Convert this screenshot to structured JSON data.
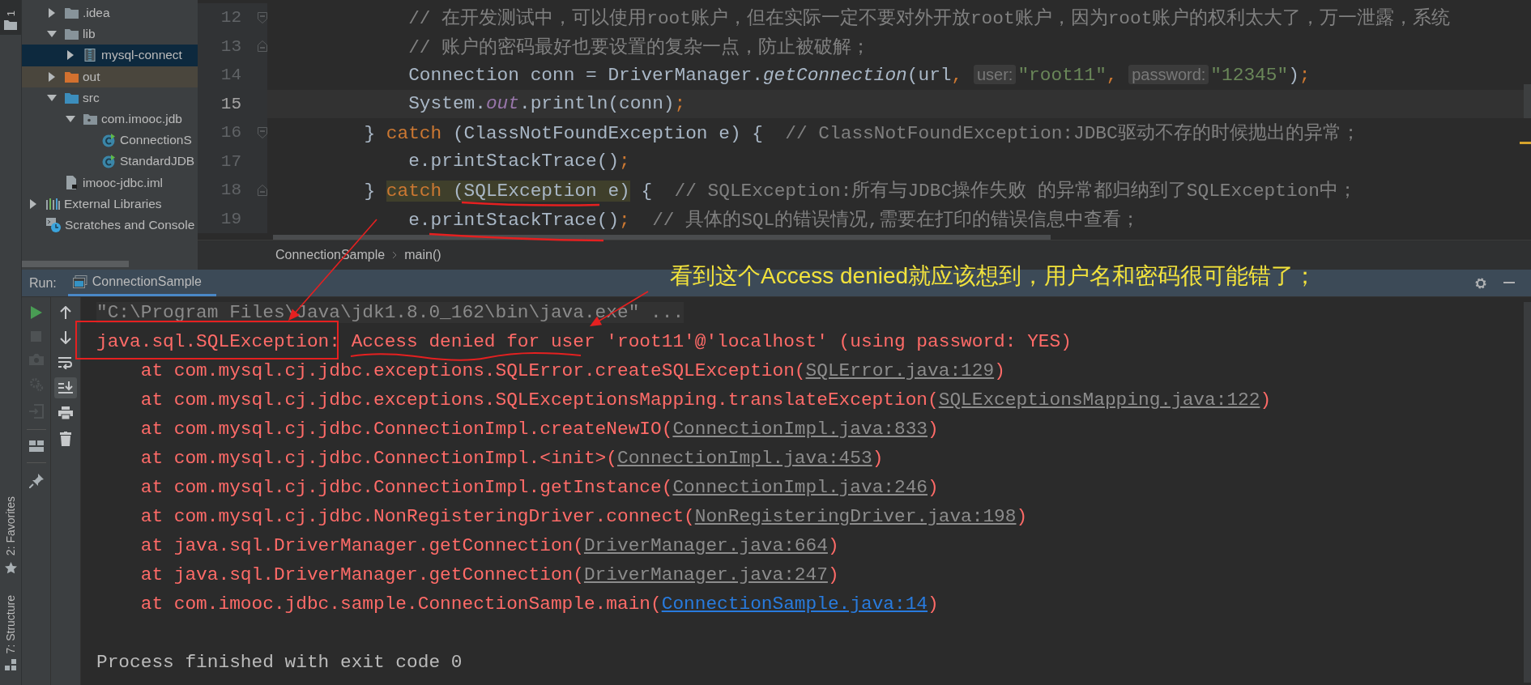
{
  "side_strip": {
    "top_tab": "1",
    "tabs": [
      {
        "label": "2: Favorites",
        "kind": "favorites"
      },
      {
        "label": "7: Structure",
        "kind": "structure"
      }
    ]
  },
  "project_tree": [
    {
      "children": [
        {
          "label": ".idea",
          "kind": "folder",
          "expanded": false,
          "selected": false
        },
        {
          "label": "lib",
          "kind": "folder",
          "expanded": true,
          "selected": false,
          "children": [
            {
              "label": "mysql-connect",
              "kind": "jar",
              "expanded": false,
              "selected": true
            }
          ]
        },
        {
          "label": "out",
          "kind": "excluded-folder",
          "expanded": false,
          "selected": false
        },
        {
          "label": "src",
          "kind": "source-folder",
          "expanded": true,
          "selected": false,
          "children": [
            {
              "label": "com.imooc.jdb",
              "kind": "package",
              "expanded": true,
              "selected": false,
              "children": [
                {
                  "label": "ConnectionS",
                  "kind": "class",
                  "selected": false
                },
                {
                  "label": "StandardJDB",
                  "kind": "class",
                  "selected": false
                }
              ]
            }
          ]
        },
        {
          "label": "imooc-jdbc.iml",
          "kind": "module-file",
          "selected": false
        }
      ]
    },
    {
      "label": "External Libraries",
      "kind": "libraries",
      "expanded": false,
      "selected": false
    },
    {
      "label": "Scratches and Console",
      "kind": "scratches",
      "selected": false
    }
  ],
  "editor": {
    "lines": [
      {
        "number": "12",
        "kind": "fold-start",
        "current": false,
        "nested": true,
        "tokens": [
          {
            "kind": "comment",
            "text": "// 在开发测试中，可以使用root账户，但在实际一定不要对外开放root账户，因为root账户的权利太大了，万一泄露，系统"
          }
        ]
      },
      {
        "number": "13",
        "kind": "fold-end",
        "current": false,
        "nested": true,
        "tokens": [
          {
            "kind": "comment",
            "text": "// 账户的密码最好也要设置的复杂一点，防止被破解；"
          }
        ]
      },
      {
        "number": "14",
        "kind": "code",
        "current": false,
        "nested": true,
        "tokens": [
          {
            "kind": "plain",
            "text": "Connection conn = DriverManager."
          },
          {
            "kind": "call",
            "text": "getConnection"
          },
          {
            "kind": "plain",
            "text": "(url"
          },
          {
            "kind": "punct",
            "text": ", "
          },
          {
            "kind": "hint",
            "text": "user:"
          },
          {
            "kind": "string",
            "text": "\"root11\""
          },
          {
            "kind": "punct",
            "text": ", "
          },
          {
            "kind": "hint",
            "text": "password:"
          },
          {
            "kind": "string",
            "text": "\"12345\""
          },
          {
            "kind": "plain",
            "text": ")"
          },
          {
            "kind": "punct",
            "text": ";"
          }
        ]
      },
      {
        "number": "15",
        "kind": "code",
        "current": true,
        "nested": true,
        "tokens": [
          {
            "kind": "plain",
            "text": "System."
          },
          {
            "kind": "field",
            "text": "out"
          },
          {
            "kind": "plain",
            "text": ".println(conn)"
          },
          {
            "kind": "punct",
            "text": ";"
          }
        ]
      },
      {
        "number": "16",
        "kind": "fold-start",
        "current": false,
        "nested": false,
        "tokens": [
          {
            "kind": "plain",
            "text": "} "
          },
          {
            "kind": "keyword",
            "text": "catch"
          },
          {
            "kind": "plain",
            "text": " (ClassNotFoundException e) {  "
          },
          {
            "kind": "comment",
            "text": "// ClassNotFoundException:JDBC驱动不存的时候抛出的异常；"
          }
        ]
      },
      {
        "number": "17",
        "kind": "code",
        "current": false,
        "nested": true,
        "tokens": [
          {
            "kind": "plain",
            "text": "e.printStackTrace()"
          },
          {
            "kind": "punct",
            "text": ";"
          }
        ]
      },
      {
        "number": "18",
        "kind": "fold-end",
        "current": false,
        "nested": false,
        "tokens": [
          {
            "kind": "plain",
            "text": "} ",
            "highlighted": false
          },
          {
            "kind": "keyword",
            "text": "catch",
            "highlighted": true
          },
          {
            "kind": "plain",
            "text": " (SQLException e)",
            "highlighted": true
          },
          {
            "kind": "plain",
            "text": " {  ",
            "highlighted": false
          },
          {
            "kind": "comment",
            "text": "// SQLException:所有与JDBC操作失败 的异常都归纳到了SQLException中；",
            "highlighted": false
          }
        ]
      },
      {
        "number": "19",
        "kind": "code",
        "current": false,
        "nested": true,
        "tokens": [
          {
            "kind": "plain",
            "text": "e.printStackTrace()"
          },
          {
            "kind": "punct",
            "text": ";"
          },
          {
            "kind": "comment",
            "text": "  // 具体的SQL的错误情况,需要在打印的错误信息中查看；"
          }
        ]
      }
    ]
  },
  "breadcrumbs": [
    "ConnectionSample",
    "main()"
  ],
  "run": {
    "label": "Run:",
    "tabs": [
      {
        "label": "ConnectionSample",
        "selected": true
      }
    ],
    "console": [
      {
        "kind": "output",
        "segments": [
          {
            "kind": "command",
            "text": "\"C:\\Program Files\\Java\\jdk1.8.0_162\\bin\\java.exe\" ..."
          }
        ]
      },
      {
        "kind": "output",
        "segments": [
          {
            "kind": "error",
            "text": "java.sql.SQLException: Access denied for user 'root11'@'localhost' (using password: YES)"
          }
        ]
      },
      {
        "kind": "frame",
        "segments": [
          {
            "kind": "error",
            "text": "at com.mysql.cj.jdbc.exceptions.SQLError.createSQLException("
          },
          {
            "kind": "link",
            "text": "SQLError.java:129"
          },
          {
            "kind": "error",
            "text": ")"
          }
        ]
      },
      {
        "kind": "frame",
        "segments": [
          {
            "kind": "error",
            "text": "at com.mysql.cj.jdbc.exceptions.SQLExceptionsMapping.translateException("
          },
          {
            "kind": "link",
            "text": "SQLExceptionsMapping.java:122"
          },
          {
            "kind": "error",
            "text": ")"
          }
        ]
      },
      {
        "kind": "frame",
        "segments": [
          {
            "kind": "error",
            "text": "at com.mysql.cj.jdbc.ConnectionImpl.createNewIO("
          },
          {
            "kind": "link",
            "text": "ConnectionImpl.java:833"
          },
          {
            "kind": "error",
            "text": ")"
          }
        ]
      },
      {
        "kind": "frame",
        "segments": [
          {
            "kind": "error",
            "text": "at com.mysql.cj.jdbc.ConnectionImpl.<init>("
          },
          {
            "kind": "link",
            "text": "ConnectionImpl.java:453"
          },
          {
            "kind": "error",
            "text": ")"
          }
        ]
      },
      {
        "kind": "frame",
        "segments": [
          {
            "kind": "error",
            "text": "at com.mysql.cj.jdbc.ConnectionImpl.getInstance("
          },
          {
            "kind": "link",
            "text": "ConnectionImpl.java:246"
          },
          {
            "kind": "error",
            "text": ")"
          }
        ]
      },
      {
        "kind": "frame",
        "segments": [
          {
            "kind": "error",
            "text": "at com.mysql.cj.jdbc.NonRegisteringDriver.connect("
          },
          {
            "kind": "link",
            "text": "NonRegisteringDriver.java:198"
          },
          {
            "kind": "error",
            "text": ")"
          }
        ]
      },
      {
        "kind": "frame",
        "segments": [
          {
            "kind": "error",
            "text": "at java.sql.DriverManager.getConnection("
          },
          {
            "kind": "link",
            "text": "DriverManager.java:664"
          },
          {
            "kind": "error",
            "text": ")"
          }
        ]
      },
      {
        "kind": "frame",
        "segments": [
          {
            "kind": "error",
            "text": "at java.sql.DriverManager.getConnection("
          },
          {
            "kind": "link",
            "text": "DriverManager.java:247"
          },
          {
            "kind": "error",
            "text": ")"
          }
        ]
      },
      {
        "kind": "frame",
        "segments": [
          {
            "kind": "error",
            "text": "at com.imooc.jdbc.sample.ConnectionSample.main("
          },
          {
            "kind": "source-link",
            "text": "ConnectionSample.java:14"
          },
          {
            "kind": "error",
            "text": ")"
          }
        ]
      },
      {
        "kind": "summary",
        "segments": [
          {
            "kind": "plain",
            "text": "Process finished with exit code 0"
          }
        ]
      }
    ]
  },
  "annotation": "看到这个Access denied就应该想到，用户名和密码很可能错了；"
}
